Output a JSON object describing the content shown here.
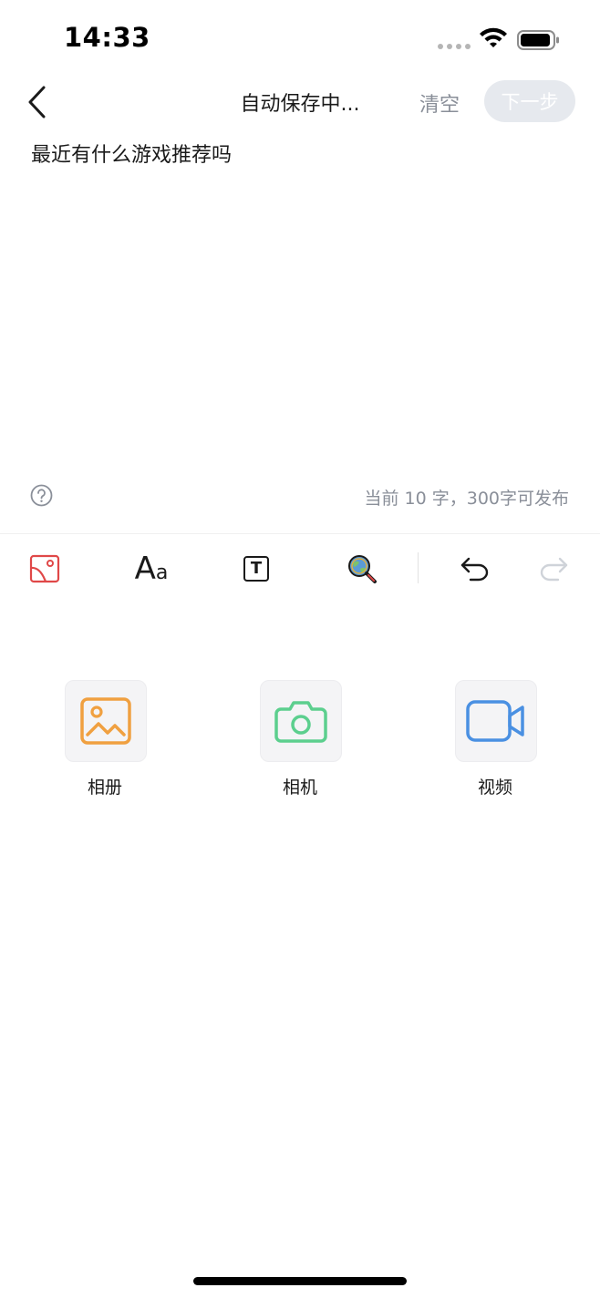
{
  "status_bar": {
    "time": "14:33"
  },
  "header": {
    "title": "自动保存中...",
    "clear_label": "清空",
    "next_label": "下一步"
  },
  "editor": {
    "text": "最近有什么游戏推荐吗",
    "word_count": "当前 10 字，300字可发布"
  },
  "toolbar": {
    "font_label_big": "A",
    "font_label_small": "a",
    "text_box_label": "T"
  },
  "media": {
    "items": [
      {
        "label": "相册",
        "icon": "album-icon",
        "color": "#F0A040"
      },
      {
        "label": "相机",
        "icon": "camera-icon",
        "color": "#5CCF8E"
      },
      {
        "label": "视频",
        "icon": "video-icon",
        "color": "#4A90E2"
      }
    ]
  },
  "colors": {
    "accent_red": "#E04848",
    "muted": "#8A8F99",
    "disabled_button": "#E6E9EE"
  }
}
